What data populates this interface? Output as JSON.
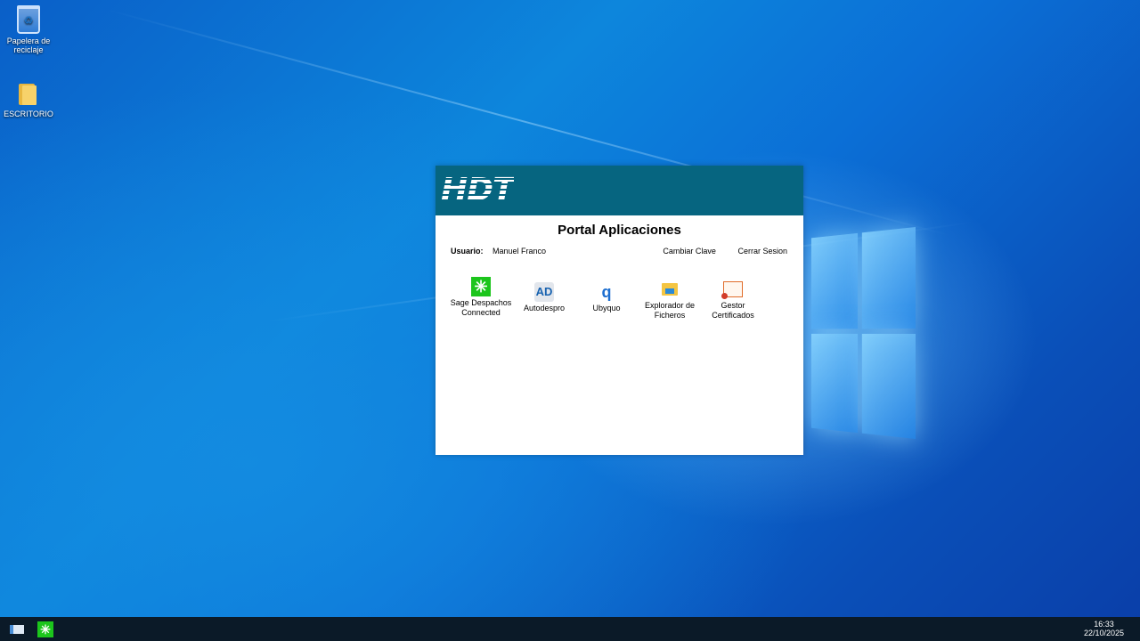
{
  "desktop": {
    "icons": [
      {
        "label": "Papelera de reciclaje"
      },
      {
        "label": "ESCRITORIO"
      }
    ]
  },
  "portal": {
    "logo": "HDT",
    "title": "Portal Aplicaciones",
    "user_label": "Usuario:",
    "user_name": "Manuel Franco",
    "change_password": "Cambiar Clave",
    "logout": "Cerrar Sesion",
    "apps": [
      {
        "label": "Sage Despachos Connected",
        "icon": "sage-icon"
      },
      {
        "label": "Autodespro",
        "icon": "autodespro-icon"
      },
      {
        "label": "Ubyquo",
        "icon": "ubyquo-icon"
      },
      {
        "label": "Explorador de Ficheros",
        "icon": "file-explorer-icon"
      },
      {
        "label": "Gestor Certificados",
        "icon": "certificate-icon"
      }
    ],
    "colors": {
      "header": "#066580",
      "body": "#ffffff"
    }
  },
  "taskbar": {
    "time": "16:33",
    "date": "22/10/2025"
  }
}
